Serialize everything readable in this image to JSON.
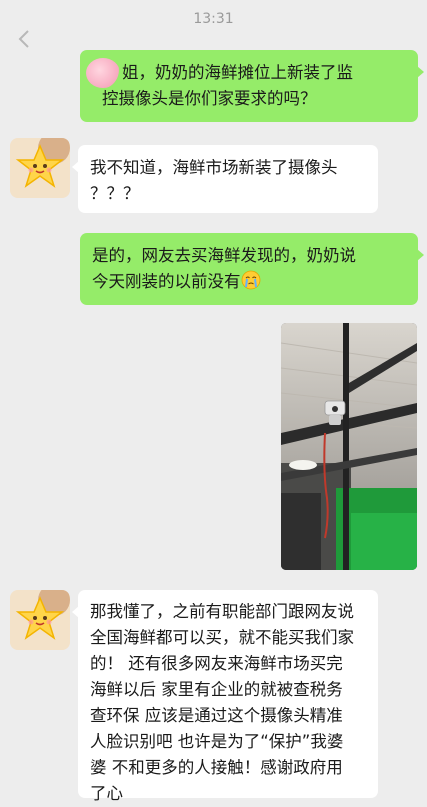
{
  "status_bar": {
    "time": "13:31"
  },
  "icons": {
    "back": "chevron-left-icon",
    "avatar": "star-sticker-avatar",
    "emoji": "crying-face-icon"
  },
  "colors": {
    "outgoing_bubble": "#95ec69",
    "incoming_bubble": "#ffffff",
    "background": "#ededed"
  },
  "messages": [
    {
      "direction": "outgoing",
      "lines": [
        "姐，奶奶的海鲜摊位上新装了监",
        "控摄像头是你们家要求的吗？"
      ]
    },
    {
      "direction": "incoming",
      "lines": [
        "我不知道，海鲜市场新装了摄像头",
        "？？？"
      ]
    },
    {
      "direction": "outgoing",
      "lines": [
        "是的，网友去买海鲜发现的，奶奶说",
        "今天刚装的以前没有"
      ]
    },
    {
      "direction": "outgoing",
      "type": "image",
      "content": "photo of a surveillance camera mounted on a metal beam above a market stall"
    },
    {
      "direction": "incoming",
      "lines": [
        "那我懂了，之前有职能部门跟网友说",
        "全国海鲜都可以买，就不能买我们家",
        "的！ 还有很多网友来海鲜市场买完",
        "海鲜以后 家里有企业的就被查税务",
        "查环保 应该是通过这个摄像头精准",
        "人脸识别吧 也许是为了“保护”我婆",
        "婆 不和更多的人接触！感谢政府用",
        "了心"
      ]
    }
  ]
}
